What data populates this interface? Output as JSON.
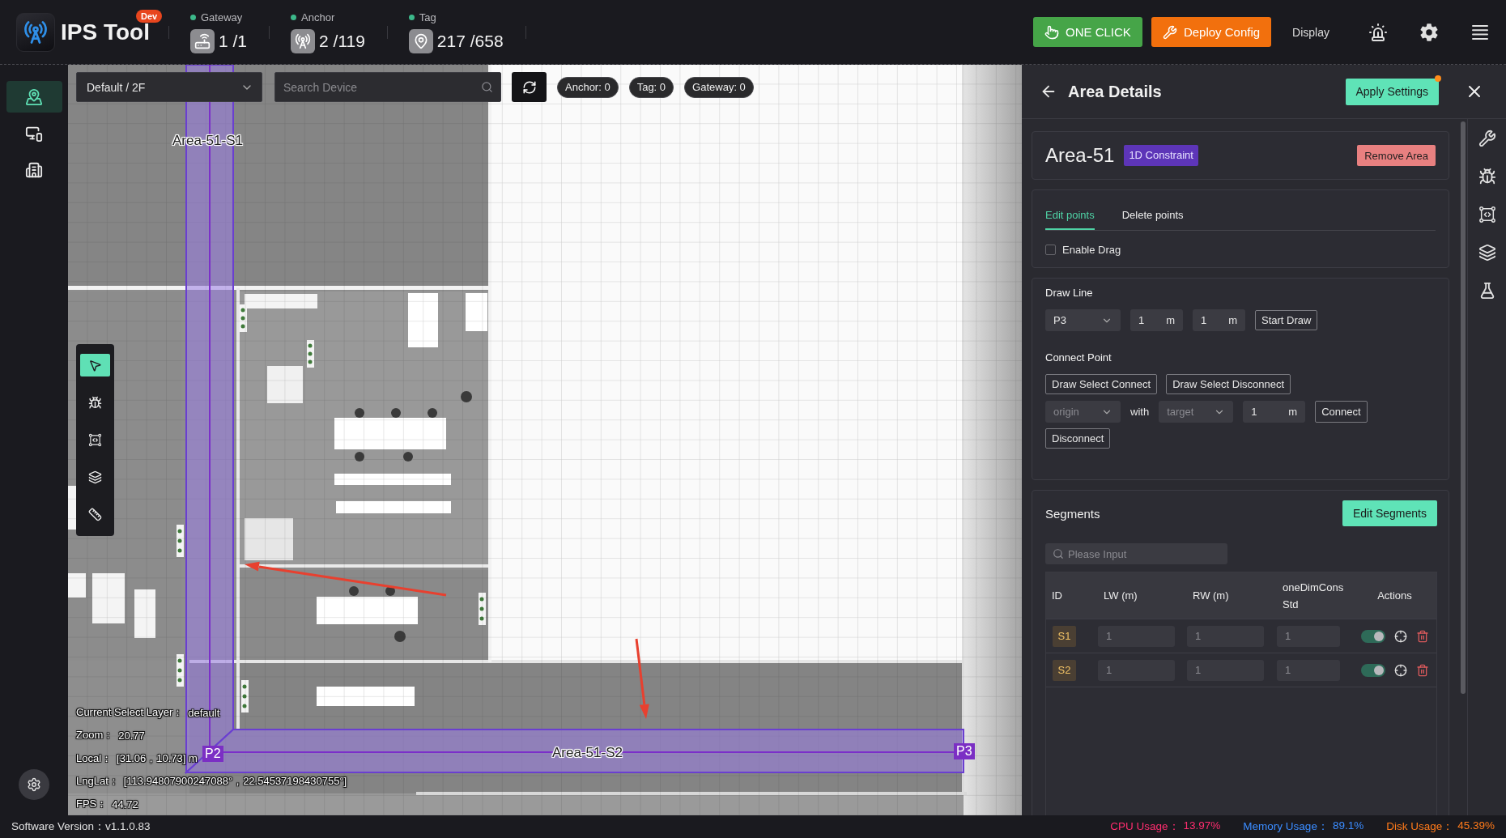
{
  "header": {
    "app_name": "IPS Tool",
    "badge": "Dev",
    "stats": [
      {
        "kind": "gateway",
        "label": "Gateway",
        "value": "1 /1",
        "online": true
      },
      {
        "kind": "anchor",
        "label": "Anchor",
        "value": "2 /119",
        "online": true
      },
      {
        "kind": "tag",
        "label": "Tag",
        "value": "217 /658",
        "online": true
      }
    ],
    "buttons": [
      {
        "kind": "success",
        "label": "ONE CLICK"
      },
      {
        "kind": "warning",
        "label": "Deploy Config"
      },
      {
        "kind": "text",
        "label": "Display"
      }
    ]
  },
  "sidebar": {
    "items": [
      {
        "kind": "map",
        "selected": true
      },
      {
        "kind": "devices",
        "selected": false
      },
      {
        "kind": "building",
        "selected": false
      }
    ]
  },
  "map": {
    "floor_select": "Default / 2F",
    "search": {
      "placeholder": "Search Device"
    },
    "counters": [
      "Anchor: 0",
      "Tag: 0",
      "Gateway: 0"
    ],
    "tools": [
      {
        "kind": "select",
        "selected": true
      },
      {
        "kind": "debug",
        "selected": false
      },
      {
        "kind": "area",
        "selected": false
      },
      {
        "kind": "layers",
        "selected": false
      },
      {
        "kind": "ruler",
        "selected": false
      }
    ],
    "areas": [
      {
        "label": "Area-51-S1"
      },
      {
        "label": "Area-51-S2"
      }
    ],
    "points": [
      "P2",
      "P3"
    ],
    "info": [
      {
        "label": "Current Select Layer：",
        "value": "default"
      },
      {
        "label": "Zoom：",
        "value": "20.77"
      },
      {
        "label": "Local：",
        "value": "[31.06，10.73] m"
      },
      {
        "label": "LngLat：",
        "value": "[113.94807900247088°，22.54537198430755°]"
      },
      {
        "label": "FPS：",
        "value": "44.72"
      }
    ]
  },
  "panel": {
    "title": "Area Details",
    "apply_button": "Apply Settings",
    "apply_pending": true,
    "area": {
      "name": "Area-51",
      "tag": "1D Constraint",
      "remove_button": "Remove Area"
    },
    "tabs": [
      {
        "label": "Edit points",
        "selected": true
      },
      {
        "label": "Delete points",
        "selected": false
      }
    ],
    "enable_drag": {
      "label": "Enable Drag",
      "checked": false
    },
    "draw_line": {
      "title": "Draw Line",
      "point_select": "P3",
      "inputs": [
        {
          "value": "1",
          "unit": "m"
        },
        {
          "value": "1",
          "unit": "m"
        }
      ],
      "button": "Start Draw"
    },
    "connect_point": {
      "title": "Connect Point",
      "buttons": [
        "Draw Select Connect",
        "Draw Select Disconnect"
      ],
      "origin": {
        "placeholder": "origin"
      },
      "with_label": "with",
      "target": {
        "placeholder": "target"
      },
      "distance": {
        "value": "1",
        "unit": "m"
      },
      "connect_button": "Connect",
      "disconnect_button": "Disconnect"
    },
    "segments": {
      "title": "Segments",
      "edit_button": "Edit Segments",
      "search": {
        "placeholder": "Please Input"
      },
      "columns": [
        "ID",
        "LW (m)",
        "RW (m)",
        "oneDimCons Std",
        "Actions"
      ],
      "rows": [
        {
          "id": "S1",
          "lw": "1",
          "rw": "1",
          "std": "1",
          "enabled": true
        },
        {
          "id": "S2",
          "lw": "1",
          "rw": "1",
          "std": "1",
          "enabled": true
        }
      ]
    }
  },
  "status_bar": {
    "version": "Software Version：v1.1.0.83",
    "metrics": [
      {
        "label": "CPU Usage：",
        "value": "13.97%",
        "color": "#ff2d6f"
      },
      {
        "label": "Memory Usage：",
        "value": "89.1%",
        "color": "#3b8cff"
      },
      {
        "label": "Disk Usage：",
        "value": "45.39%",
        "color": "#ff7a1a"
      }
    ]
  }
}
